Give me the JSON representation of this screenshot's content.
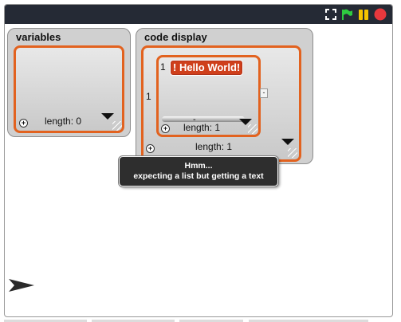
{
  "controls": {
    "fullscreen_icon": "fullscreen-icon",
    "green_flag_icon": "green-flag-icon",
    "pause_icon": "pause-icon",
    "stop_icon": "stop-icon",
    "flag_color": "#2ecc40",
    "pause_color": "#f5c400",
    "stop_color": "#e8383d"
  },
  "variables_watcher": {
    "title": "variables",
    "length_label": "length: 0",
    "plus": "+"
  },
  "code_display_watcher": {
    "title": "code display",
    "outer_index": "1",
    "inner_index_top": "1",
    "item_text": "! Hello World!",
    "side_cell": "-",
    "inner_dash": "-",
    "inner_length_label": "length: 1",
    "outer_length_label": "length: 1",
    "plus": "+"
  },
  "tooltip": {
    "line1": "Hmm...",
    "line2": "expecting a list but getting a text"
  },
  "colors": {
    "topbar": "#252a35",
    "list_border": "#e2621f",
    "item_fill": "#cf3f1b"
  }
}
